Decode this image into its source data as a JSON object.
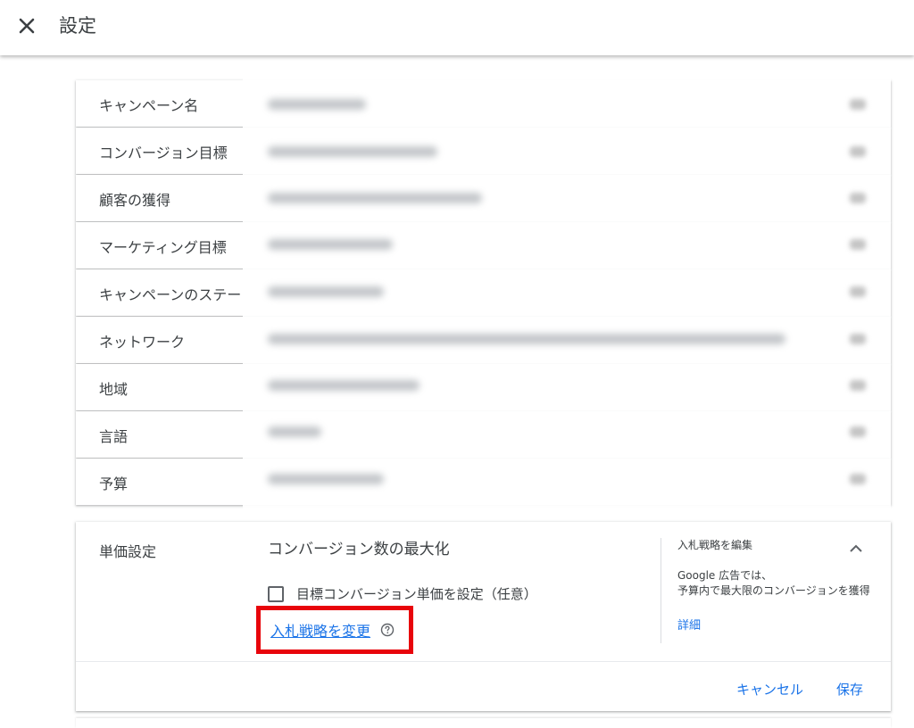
{
  "header": {
    "title": "設定",
    "close_icon": "close-icon"
  },
  "settings_rows": [
    {
      "label": "キャンペーン名"
    },
    {
      "label": "コンバージョン目標"
    },
    {
      "label": "顧客の獲得"
    },
    {
      "label": "マーケティング目標"
    },
    {
      "label": "キャンペーンのステータス"
    },
    {
      "label": "ネットワーク"
    },
    {
      "label": "地域"
    },
    {
      "label": "言語"
    },
    {
      "label": "予算"
    }
  ],
  "bidding": {
    "label": "単価設定",
    "strategy": "コンバージョン数の最大化",
    "checkbox_label": "目標コンバージョン単価を設定（任意）",
    "checkbox_checked": false,
    "change_link": "入札戦略を変更",
    "help_icon": "help-circle-icon",
    "side_title": "入札戦略を編集",
    "side_text_line1": "Google 広告では、",
    "side_text_line2": "予算内で最大限のコンバージョンを獲得",
    "side_link": "詳細",
    "collapse_icon": "chevron-up-icon",
    "cancel_label": "キャンセル",
    "save_label": "保存"
  },
  "colors": {
    "link": "#1a73e8",
    "highlight": "#e8040b",
    "text": "#3c4043"
  }
}
